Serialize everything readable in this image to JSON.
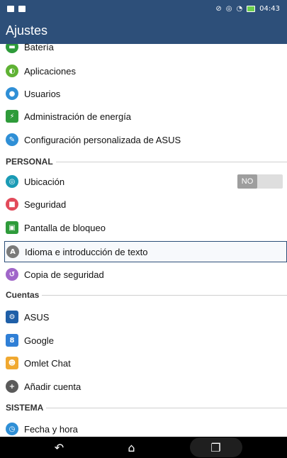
{
  "status_bar": {
    "time": "04:43"
  },
  "app_bar": {
    "title": "Ajustes"
  },
  "items_top": [
    {
      "label": "Batería",
      "icon": "battery-icon",
      "color": "#2e9b3a"
    },
    {
      "label": "Aplicaciones",
      "icon": "apps-icon",
      "color": "#5fb234"
    },
    {
      "label": "Usuarios",
      "icon": "user-icon",
      "color": "#2f8fd6"
    },
    {
      "label": "Administración de energía",
      "icon": "power-management-icon",
      "color": "#2e9b3a"
    },
    {
      "label": "Configuración personalizada de ASUS",
      "icon": "asus-custom-icon",
      "color": "#2f8fd6"
    }
  ],
  "sections": {
    "personal": "PERSONAL",
    "cuentas": "Cuentas",
    "sistema": "SISTEMA"
  },
  "items_personal": [
    {
      "label": "Ubicación",
      "icon": "location-icon",
      "color": "#1a9bb5",
      "toggle": "NO"
    },
    {
      "label": "Seguridad",
      "icon": "lock-icon",
      "color": "#e24a5a"
    },
    {
      "label": "Pantalla de bloqueo",
      "icon": "lockscreen-icon",
      "color": "#2e9b3a"
    },
    {
      "label": "Idioma e introducción de texto",
      "icon": "language-icon",
      "color": "#7a7a7a"
    },
    {
      "label": "Copia de seguridad",
      "icon": "backup-icon",
      "color": "#a066c9"
    }
  ],
  "items_cuentas": [
    {
      "label": "ASUS",
      "icon": "asus-account-icon",
      "color": "#1f5fa8"
    },
    {
      "label": "Google",
      "icon": "google-icon",
      "color": "#2f7fd6"
    },
    {
      "label": "Omlet Chat",
      "icon": "omlet-icon",
      "color": "#f0a830"
    },
    {
      "label": "Añadir cuenta",
      "icon": "add-account-icon",
      "color": "#5a5a5a"
    }
  ],
  "items_sistema": [
    {
      "label": "Fecha y hora",
      "icon": "clock-icon",
      "color": "#2f8fd6"
    }
  ]
}
